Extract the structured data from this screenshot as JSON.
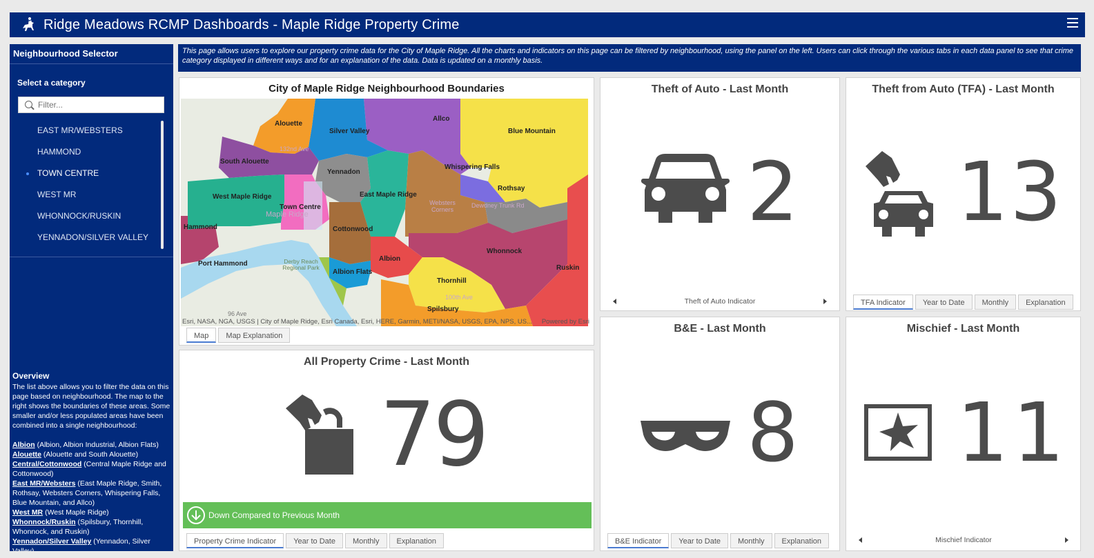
{
  "header": {
    "title": "Ridge Meadows RCMP Dashboards - Maple Ridge Property Crime",
    "logo_icon": "rcmp-horse-rider-icon",
    "menu_icon": "hamburger-menu-icon"
  },
  "sidebar": {
    "heading": "Neighbourhood Selector",
    "category_label": "Select a category",
    "filter_placeholder": "Filter...",
    "items": [
      {
        "label": "EAST MR/WEBSTERS",
        "selected": false
      },
      {
        "label": "HAMMOND",
        "selected": false
      },
      {
        "label": "TOWN CENTRE",
        "selected": true
      },
      {
        "label": "WEST MR",
        "selected": false
      },
      {
        "label": "WHONNOCK/RUSKIN",
        "selected": false
      },
      {
        "label": "YENNADON/SILVER VALLEY",
        "selected": false
      }
    ],
    "overview_title": "Overview",
    "overview_text": "The list above allows you to filter the data on this page based on neighbourhood. The map to the right shows the boundaries of these areas. Some smaller and/or less populated areas have been combined into a single neighbourhood:",
    "neighbourhoods": [
      {
        "name": "Albion",
        "desc": " (Albion, Albion Industrial, Albion Flats)"
      },
      {
        "name": "Alouette",
        "desc": " (Alouette and South Alouette)"
      },
      {
        "name": "Central/Cottonwood",
        "desc": " (Central Maple Ridge and Cottonwood)"
      },
      {
        "name": "East MR/Websters",
        "desc": " (East Maple Ridge, Smith, Rothsay, Websters Corners, Whispering Falls, Blue Mountain, and Allco)"
      },
      {
        "name": "West MR",
        "desc": " (West Maple Ridge)"
      },
      {
        "name": "Whonnock/Ruskin",
        "desc": " (Spilsbury, Thornhill, Whonnock, and Ruskin)"
      },
      {
        "name": "Yennadon/Silver Valley",
        "desc": " (Yennadon, Silver Valley)"
      }
    ]
  },
  "banner": {
    "text": "This page allows users to explore our property crime data for the City of Maple Ridge. All the charts and indicators on this page can be filtered by neighbourhood, using the panel on the left. Users can click through the various tabs in each data panel to see that crime category displayed in different ways and for an explanation of the data. Data is updated on a monthly basis."
  },
  "map_panel": {
    "title": "City of Maple Ridge Neighbourhood Boundaries",
    "labels": {
      "alouette": "Alouette",
      "silver_valley": "Silver Valley",
      "allco": "Allco",
      "blue_mountain": "Blue Mountain",
      "south_alouette": "South Alouette",
      "yennadon": "Yennadon",
      "whispering_falls": "Whispering Falls",
      "rothsay": "Rothsay",
      "east_maple_ridge": "East Maple Ridge",
      "west_maple_ridge": "West Maple Ridge",
      "town_centre": "Town Centre",
      "hammond": "Hammond",
      "cottonwood": "Cottonwood",
      "whonnock": "Whonnock",
      "ruskin": "Ruskin",
      "port_hammond": "Port Hammond",
      "albion": "Albion",
      "albion_flats": "Albion Flats",
      "thornhill": "Thornhill",
      "spilsbury": "Spilsbury",
      "derby_reach": "Derby Reach Regional Park",
      "maple_ridge": "Maple Ridge",
      "websters_corners": "Websters Corners",
      "ave_132": "132nd Ave",
      "ave_96": "96 Ave",
      "ave_100": "100th Ave",
      "dewdney": "Dewdney Trunk Rd"
    },
    "attribution": "Esri, NASA, NGA, USGS | City of Maple Ridge, Esri Canada, Esri, HERE, Garmin, METI/NASA, USGS, EPA, NPS, US...",
    "powered_by": "Powered by Esri",
    "tabs": [
      "Map",
      "Map Explanation"
    ]
  },
  "all_property": {
    "title": "All Property Crime - Last Month",
    "value": "79",
    "icon": "hand-bag-theft-icon",
    "status_text": "Down Compared to Previous Month",
    "status_icon": "arrow-down-circle-icon",
    "status_color": "#64bf58",
    "tabs": [
      "Property Crime Indicator",
      "Year to Date",
      "Monthly",
      "Explanation"
    ]
  },
  "theft_auto": {
    "title": "Theft of Auto - Last Month",
    "value": "2",
    "icon": "car-icon",
    "nav_label": "Theft of Auto Indicator"
  },
  "tfa": {
    "title": "Theft from Auto (TFA) - Last Month",
    "value": "13",
    "icon": "hand-car-theft-icon",
    "tabs": [
      "TFA Indicator",
      "Year to Date",
      "Monthly",
      "Explanation"
    ]
  },
  "be": {
    "title": "B&E - Last Month",
    "value": "8",
    "icon": "burglar-mask-icon",
    "tabs": [
      "B&E Indicator",
      "Year to Date",
      "Monthly",
      "Explanation"
    ]
  },
  "mischief": {
    "title": "Mischief - Last Month",
    "value": "11",
    "icon": "broken-window-icon",
    "nav_label": "Mischief Indicator"
  },
  "colors": {
    "brand": "#022a7c",
    "status_green": "#64bf58",
    "number_gray": "#4c4c4c"
  }
}
